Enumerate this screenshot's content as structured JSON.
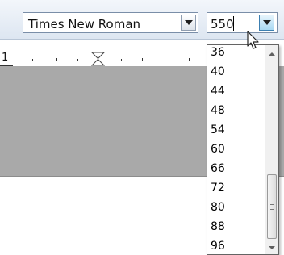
{
  "toolbar": {
    "font_name": "Times New Roman",
    "font_size": "550"
  },
  "ruler": {
    "label": "1"
  },
  "size_dropdown": {
    "options": [
      "36",
      "40",
      "44",
      "48",
      "54",
      "60",
      "66",
      "72",
      "80",
      "88",
      "96"
    ]
  },
  "icons": {
    "font_dropdown": "chevron-down-icon",
    "size_dropdown": "chevron-down-icon",
    "cursor": "mouse-pointer-icon",
    "indent": "hourglass-indent-marker-icon",
    "scroll_up": "scroll-up-arrow-icon",
    "scroll_down": "scroll-down-arrow-icon"
  },
  "colors": {
    "toolbar_top": "#f3f6fb",
    "toolbar_bottom": "#dde6f1",
    "document_gray": "#a9a9a9",
    "dropdown_button_hover": "#a9d9f3"
  }
}
